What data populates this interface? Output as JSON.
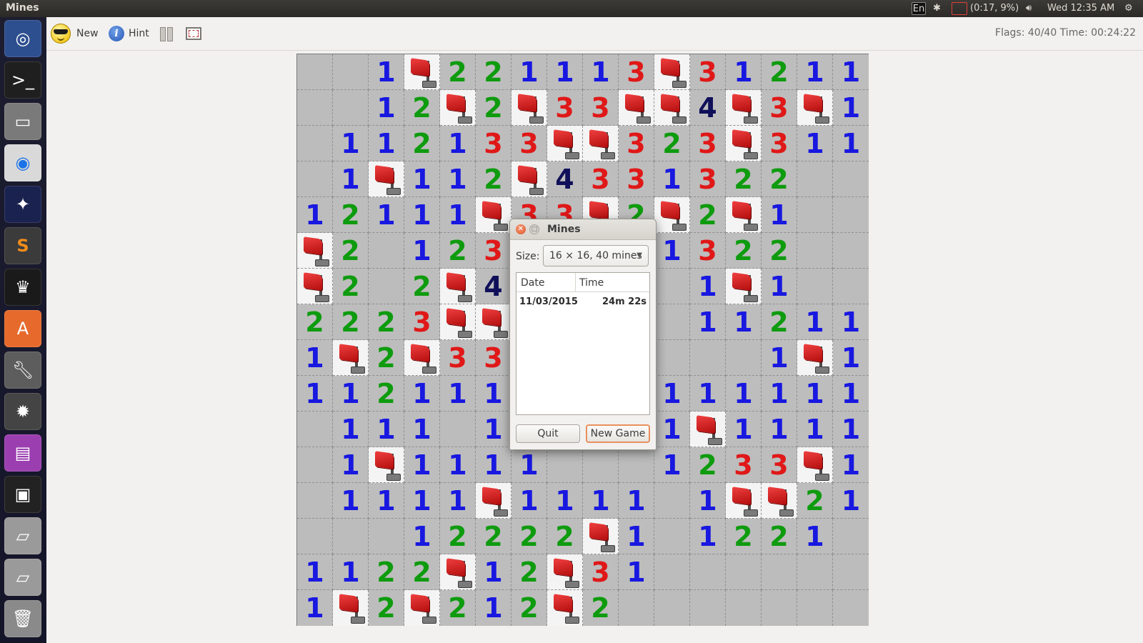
{
  "topbar": {
    "app_title": "Mines",
    "keyboard": "En",
    "bluetooth_icon": "bluetooth-icon",
    "battery": "(0:17, 9%)",
    "volume_icon": "volume-icon",
    "clock": "Wed 12:35 AM",
    "settings_icon": "gear-icon"
  },
  "launcher": {
    "items": [
      "ubuntu-dash-icon",
      "terminal-icon",
      "file-manager-icon",
      "chrome-icon",
      "dark-app-icon",
      "sublime-text-icon",
      "game-icon",
      "software-center-icon",
      "system-settings-icon",
      "mines-icon",
      "workspace-icon",
      "workspace-switcher-icon",
      "drive-icon",
      "drive-icon",
      "trash-icon"
    ]
  },
  "toolbar": {
    "new_label": "New",
    "hint_label": "Hint",
    "flags_time": "Flags: 40/40   Time: 00:24:22"
  },
  "board": {
    "size": 16,
    "rows": [
      "..1F2211113F3121 1",
      "..12F2F33FF4F3F1",
      ".1121331FF323F311",
      ".1F112F4331322..",
      "1211 1F33F2F2F21..",
      "F2.123........",
      "F2.2F4..........",
      "2223FF..........",
      "1F2F33..........",
      "112111..........",
      ".111.1..........",
      ".1F1111.........",
      ".1111F1111.1FF21",
      "...122222F1.1221.",
      "1122F12F31......",
      "1F2F2122F2......"
    ],
    "grid": [
      [
        ".",
        ".",
        "1",
        "F",
        "2",
        "2",
        "1",
        "1",
        "1",
        "3",
        "F",
        "3",
        "1",
        "2",
        "1",
        "1"
      ],
      [
        ".",
        ".",
        "1",
        "2",
        "F",
        "2",
        "F",
        "3",
        "3",
        "F",
        "F",
        "4",
        "F",
        "3",
        "F",
        "1"
      ],
      [
        ".",
        "1",
        "1",
        "2",
        "1",
        "3",
        "3",
        "F",
        "F",
        "3",
        "2",
        "3",
        "F",
        "3",
        "1",
        "1"
      ],
      [
        ".",
        "1",
        "F",
        "1",
        "1",
        "2",
        "F",
        "4",
        "3",
        "3",
        "1",
        "3",
        "2",
        "2",
        ".",
        "."
      ],
      [
        "1",
        "2",
        "1",
        "1",
        "1",
        "F",
        "3",
        "3",
        "F",
        "2",
        "F",
        "2",
        "F",
        "1",
        ".",
        "."
      ],
      [
        "F",
        "2",
        ".",
        "1",
        "2",
        "3",
        "x",
        "x",
        "x",
        "x",
        "1",
        "3",
        "2",
        "2",
        ".",
        "."
      ],
      [
        "F",
        "2",
        ".",
        "2",
        "F",
        "4",
        "x",
        "x",
        "x",
        "x",
        ".",
        "1",
        "F",
        "1",
        ".",
        "."
      ],
      [
        "2",
        "2",
        "2",
        "3",
        "F",
        "F",
        "x",
        "x",
        "x",
        "x",
        ".",
        "1",
        "1",
        "2",
        "1",
        "1"
      ],
      [
        "1",
        "F",
        "2",
        "F",
        "3",
        "3",
        "x",
        "x",
        "x",
        "x",
        ".",
        ".",
        ".",
        "1",
        "F",
        "1"
      ],
      [
        "1",
        "1",
        "2",
        "1",
        "1",
        "1",
        "x",
        "x",
        "x",
        "x",
        "1",
        "1",
        "1",
        "1",
        "1",
        "1"
      ],
      [
        ".",
        "1",
        "1",
        "1",
        ".",
        "1",
        "x",
        "x",
        "x",
        "x",
        "1",
        "F",
        "1",
        "1",
        "1",
        "1"
      ],
      [
        ".",
        "1",
        "F",
        "1",
        "1",
        "1",
        "1",
        ".",
        ".",
        ".",
        "1",
        "2",
        "3",
        "3",
        "F",
        "1"
      ],
      [
        ".",
        "1",
        "1",
        "1",
        "1",
        "F",
        "1",
        "1",
        "1",
        "1",
        ".",
        "1",
        "F",
        "F",
        "2",
        "1"
      ],
      [
        ".",
        ".",
        ".",
        "1",
        "2",
        "2",
        "2",
        "2",
        "F",
        "1",
        ".",
        "1",
        "2",
        "2",
        "1",
        "."
      ],
      [
        "1",
        "1",
        "2",
        "2",
        "F",
        "1",
        "2",
        "F",
        "3",
        "1",
        ".",
        ".",
        ".",
        ".",
        ".",
        "."
      ],
      [
        "1",
        "F",
        "2",
        "F",
        "2",
        "1",
        "2",
        "F",
        "2",
        ".",
        ".",
        ".",
        ".",
        ".",
        ".",
        "."
      ]
    ],
    "number_colors": {
      "1": "#1818e0",
      "2": "#0e9b0e",
      "3": "#e01818",
      "4": "#10105a"
    }
  },
  "dialog": {
    "title": "Mines",
    "size_label": "Size:",
    "size_value": "16 × 16, 40 mines",
    "columns": [
      "Date",
      "Time"
    ],
    "scores": [
      {
        "date": "11/03/2015",
        "time": "24m 22s"
      }
    ],
    "quit_label": "Quit",
    "new_game_label": "New Game"
  }
}
